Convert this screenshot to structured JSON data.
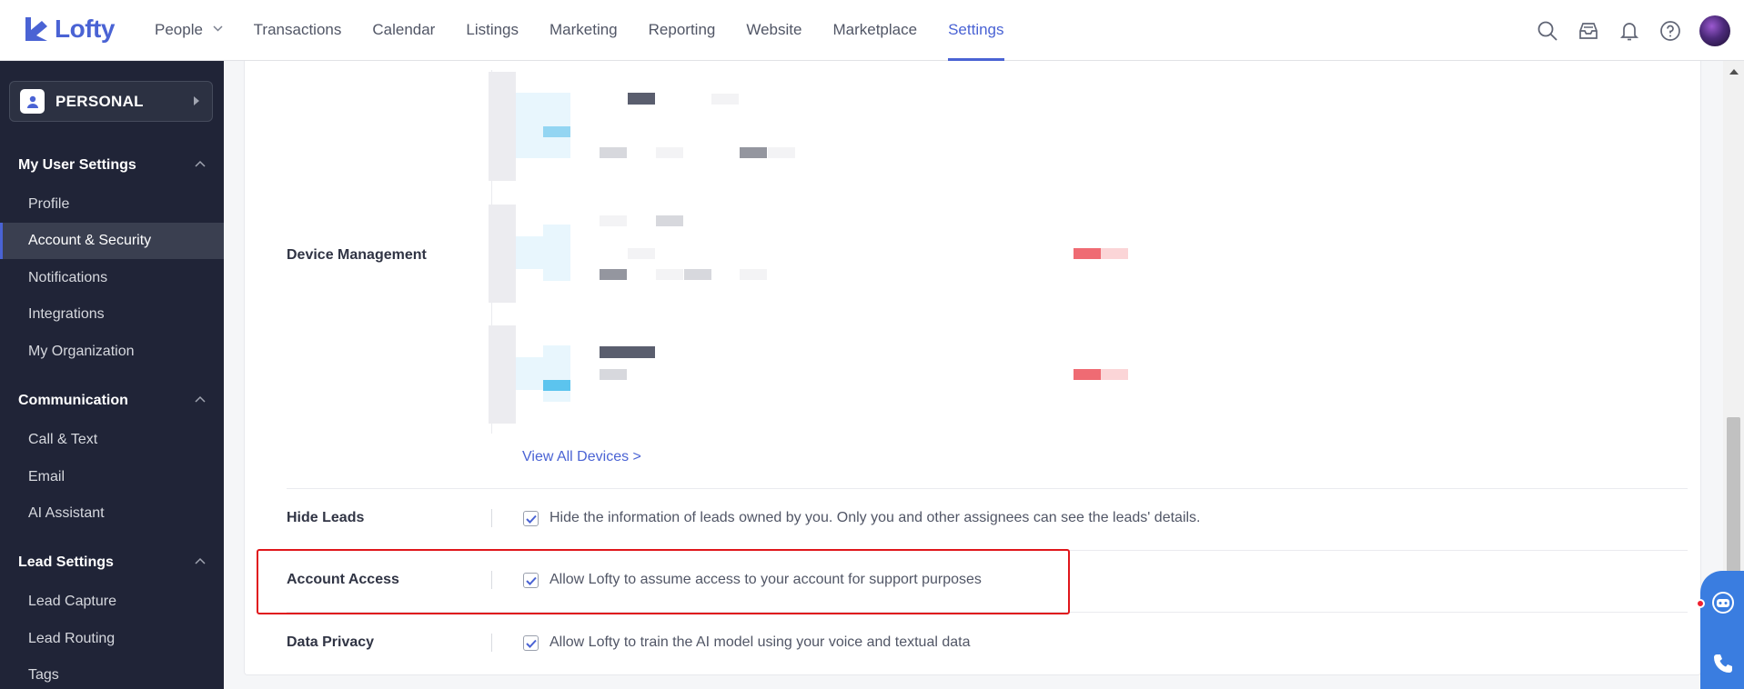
{
  "brand": {
    "name": "Lofty",
    "accent": "#4a63d4"
  },
  "nav": {
    "items": [
      {
        "label": "People",
        "has_dropdown": true
      },
      {
        "label": "Transactions"
      },
      {
        "label": "Calendar"
      },
      {
        "label": "Listings"
      },
      {
        "label": "Marketing"
      },
      {
        "label": "Reporting"
      },
      {
        "label": "Website"
      },
      {
        "label": "Marketplace"
      },
      {
        "label": "Settings",
        "active": true
      }
    ],
    "icons": [
      "search-icon",
      "inbox-icon",
      "bell-icon",
      "help-icon",
      "avatar"
    ]
  },
  "sidebar": {
    "workspace": "PERSONAL",
    "sections": [
      {
        "title": "My User Settings",
        "items": [
          "Profile",
          "Account & Security",
          "Notifications",
          "Integrations",
          "My Organization"
        ]
      },
      {
        "title": "Communication",
        "items": [
          "Call & Text",
          "Email",
          "AI Assistant"
        ]
      },
      {
        "title": "Lead Settings",
        "items": [
          "Lead Capture",
          "Lead Routing",
          "Tags"
        ]
      }
    ],
    "active_item": "Account & Security"
  },
  "main": {
    "device_management": {
      "label": "Device Management",
      "view_all": "View All Devices >"
    },
    "hide_leads": {
      "label": "Hide Leads",
      "checked": true,
      "text": "Hide the information of leads owned by you. Only you and other assignees can see the leads' details."
    },
    "account_access": {
      "label": "Account Access",
      "checked": true,
      "text": "Allow Lofty to assume access to your account for support purposes"
    },
    "data_privacy": {
      "label": "Data Privacy",
      "checked": true,
      "text": "Allow Lofty to train the AI model using your voice and textual data"
    }
  },
  "colors": {
    "highlight": "#e0161b",
    "sidebar_bg": "#202437"
  }
}
